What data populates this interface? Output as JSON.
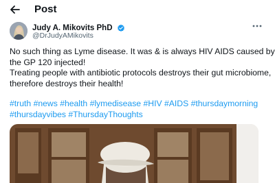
{
  "header": {
    "title": "Post"
  },
  "author": {
    "display_name": "Judy A. Mikovits PhD",
    "handle": "@DrJudyAMikovits"
  },
  "tweet": {
    "lines": [
      "No such thing as Lyme disease. It was & is always HIV AIDS caused by",
      "the GP 120 injected!",
      "Treating people with antibiotic protocols destroys their gut microbiome,",
      "therefore destroys their health!"
    ],
    "hashtags_line1": [
      "#truth",
      "#news",
      "#health",
      "#lymedisease",
      "#HIV",
      "#AIDS",
      "#thursdaymorning"
    ],
    "hashtags_line2": [
      "#thursdayvibes",
      "#ThursdayThoughts"
    ]
  },
  "colors": {
    "link": "#1d9bf0",
    "verified": "#1d9bf0",
    "text": "#0f1419",
    "secondary": "#536471"
  },
  "icons": {
    "back": "arrow-left-icon",
    "verified": "verified-badge-icon",
    "more": "more-horizontal-icon"
  }
}
